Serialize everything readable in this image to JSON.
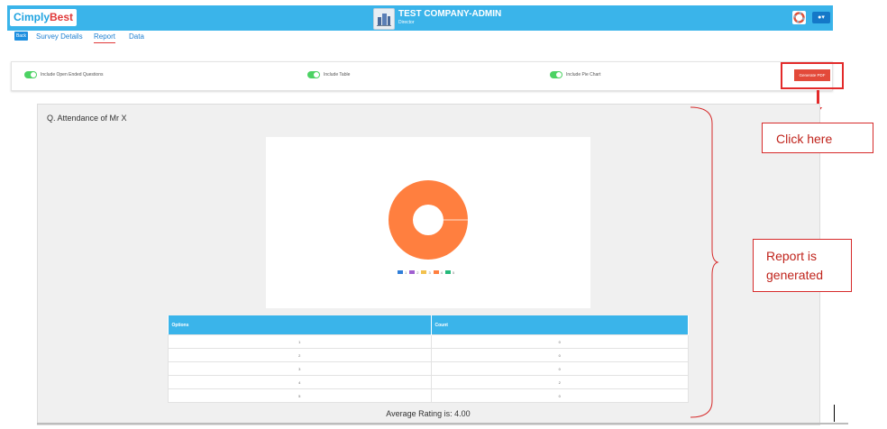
{
  "app": {
    "logo_part1": "Cimply",
    "logo_part2": "Best",
    "company_title": "TEST COMPANY-ADMIN",
    "company_subtitle": "Director",
    "icons": {
      "help": "lifebuoy-icon",
      "user": "user-icon"
    }
  },
  "nav": {
    "back": "Back",
    "survey_details": "Survey Details",
    "report": "Report",
    "data": "Data"
  },
  "options": {
    "open_ended": {
      "label": "Include Open Ended Questions",
      "on": true
    },
    "table": {
      "label": "Include Table",
      "on": true
    },
    "pie_chart": {
      "label": "Include Pie Chart",
      "on": true
    },
    "generate_pdf": "Generate PDF"
  },
  "annotations": {
    "click_here": "Click here",
    "report_line1": "Report is",
    "report_line2": "generated"
  },
  "report": {
    "question": "Q. Attendance of Mr X",
    "table_headers": [
      "Options",
      "Count"
    ],
    "rows": [
      {
        "option": "1",
        "count": "0"
      },
      {
        "option": "2",
        "count": "0"
      },
      {
        "option": "3",
        "count": "0"
      },
      {
        "option": "4",
        "count": "2"
      },
      {
        "option": "5",
        "count": "0"
      }
    ],
    "average": "Average Rating is: 4.00"
  },
  "chart_data": {
    "type": "pie",
    "donut": true,
    "categories": [
      "1",
      "2",
      "3",
      "4",
      "5"
    ],
    "values": [
      0,
      0,
      0,
      2,
      0
    ],
    "colors": [
      "#2f7ed8",
      "#a05fd0",
      "#f2c14e",
      "#ff7f3f",
      "#25b97a"
    ],
    "legend_position": "bottom"
  },
  "colors": {
    "brand": "#3ab4ea",
    "accent_red": "#e32a2a"
  }
}
